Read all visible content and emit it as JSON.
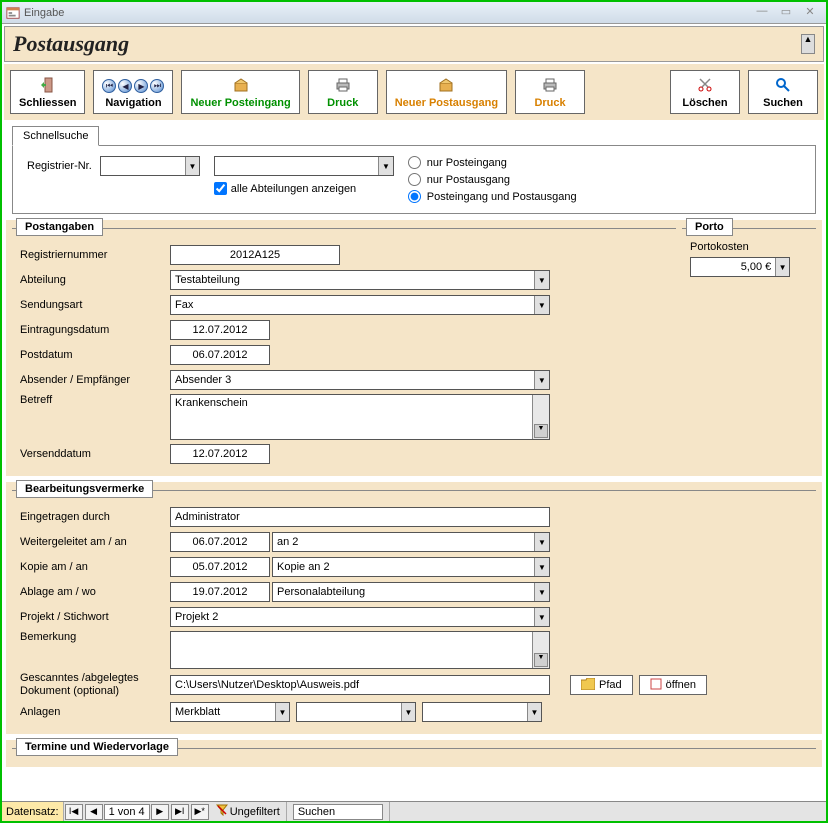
{
  "window": {
    "title": "Eingabe"
  },
  "header": {
    "title": "Postausgang"
  },
  "toolbar": {
    "close": "Schliessen",
    "nav": "Navigation",
    "newIn": "Neuer Posteingang",
    "print1": "Druck",
    "newOut": "Neuer Postausgang",
    "print2": "Druck",
    "delete": "Löschen",
    "search": "Suchen"
  },
  "quicksearch": {
    "tab": "Schnellsuche",
    "regLabel": "Registrier-Nr.",
    "allDept": "alle Abteilungen anzeigen",
    "r1": "nur Posteingang",
    "r2": "nur Postausgang",
    "r3": "Posteingang und Postausgang"
  },
  "post": {
    "title": "Postangaben",
    "regnr_l": "Registriernummer",
    "regnr_v": "2012A125",
    "abt_l": "Abteilung",
    "abt_v": "Testabteilung",
    "sart_l": "Sendungsart",
    "sart_v": "Fax",
    "edat_l": "Eintragungsdatum",
    "edat_v": "12.07.2012",
    "pdat_l": "Postdatum",
    "pdat_v": "06.07.2012",
    "abs_l": "Absender / Empfänger",
    "abs_v": "Absender 3",
    "betr_l": "Betreff",
    "betr_v": "Krankenschein",
    "vdat_l": "Versenddatum",
    "vdat_v": "12.07.2012"
  },
  "porto": {
    "title": "Porto",
    "kosten_l": "Portokosten",
    "kosten_v": "5,00 €"
  },
  "bearb": {
    "title": "Bearbeitungsvermerke",
    "eing_l": "Eingetragen durch",
    "eing_v": "Administrator",
    "weit_l": "Weitergeleitet am / an",
    "weit_d": "06.07.2012",
    "weit_v": "an 2",
    "kop_l": "Kopie am / an",
    "kop_d": "05.07.2012",
    "kop_v": "Kopie an 2",
    "abl_l": "Ablage am / wo",
    "abl_d": "19.07.2012",
    "abl_v": "Personalabteilung",
    "proj_l": "Projekt / Stichwort",
    "proj_v": "Projekt 2",
    "bem_l": "Bemerkung",
    "bem_v": "",
    "scan_l": "Gescanntes /abgelegtes Dokument (optional)",
    "scan_v": "C:\\Users\\Nutzer\\Desktop\\Ausweis.pdf",
    "pfad": "Pfad",
    "oeffnen": "öffnen",
    "anl_l": "Anlagen",
    "anl_v": "Merkblatt"
  },
  "termine": {
    "title": "Termine und Wiedervorlage"
  },
  "recnav": {
    "label": "Datensatz:",
    "pos": "1 von 4",
    "filter": "Ungefiltert",
    "search": "Suchen"
  }
}
